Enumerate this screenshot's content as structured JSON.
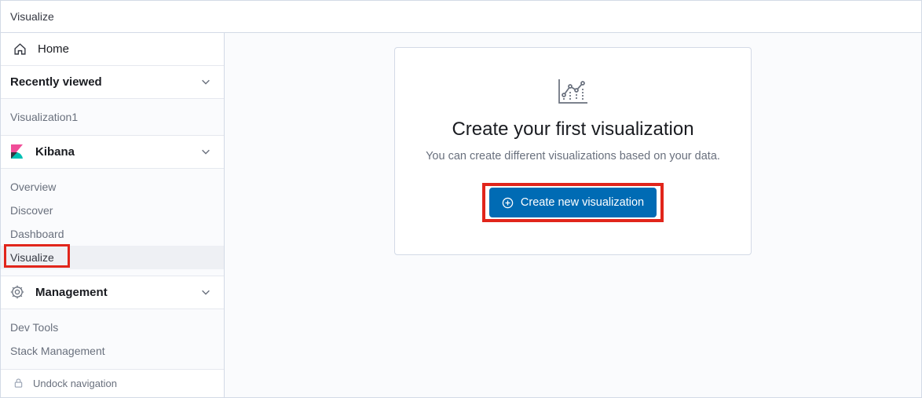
{
  "breadcrumb": "Visualize",
  "home_label": "Home",
  "sections": {
    "recently": {
      "title": "Recently viewed",
      "items": [
        "Visualization1"
      ]
    },
    "kibana": {
      "title": "Kibana",
      "items": [
        "Overview",
        "Discover",
        "Dashboard",
        "Visualize"
      ]
    },
    "management": {
      "title": "Management",
      "items": [
        "Dev Tools",
        "Stack Management"
      ]
    }
  },
  "undock_label": "Undock navigation",
  "card": {
    "title": "Create your first visualization",
    "subtitle": "You can create different visualizations based on your data.",
    "button": "Create new visualization"
  }
}
